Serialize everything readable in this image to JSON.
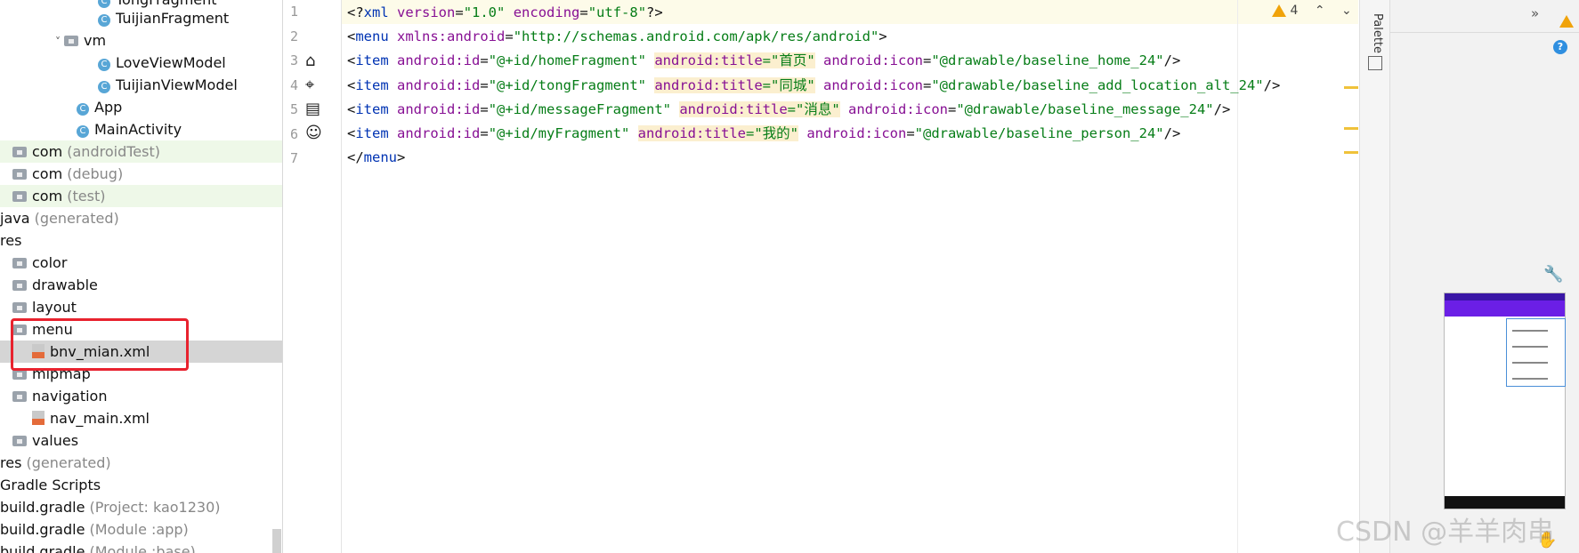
{
  "tree": {
    "rows": [
      {
        "label": "TongFragment",
        "muted": ""
      },
      {
        "label": "TuijianFragment",
        "muted": ""
      },
      {
        "label": "vm",
        "muted": ""
      },
      {
        "label": "LoveViewModel",
        "muted": ""
      },
      {
        "label": "TuijianViewModel",
        "muted": ""
      },
      {
        "label": "App",
        "muted": ""
      },
      {
        "label": "MainActivity",
        "muted": ""
      },
      {
        "label": "com",
        "muted": "(androidTest)"
      },
      {
        "label": "com",
        "muted": "(debug)"
      },
      {
        "label": "com",
        "muted": "(test)"
      },
      {
        "label": "java",
        "muted": "(generated)"
      },
      {
        "label": "res",
        "muted": ""
      },
      {
        "label": "color",
        "muted": ""
      },
      {
        "label": "drawable",
        "muted": ""
      },
      {
        "label": "layout",
        "muted": ""
      },
      {
        "label": "menu",
        "muted": ""
      },
      {
        "label": "bnv_mian.xml",
        "muted": ""
      },
      {
        "label": "mipmap",
        "muted": ""
      },
      {
        "label": "navigation",
        "muted": ""
      },
      {
        "label": "nav_main.xml",
        "muted": ""
      },
      {
        "label": "values",
        "muted": ""
      },
      {
        "label": "res",
        "muted": "(generated)"
      },
      {
        "label": "Gradle Scripts",
        "muted": ""
      },
      {
        "label": "build.gradle",
        "muted": "(Project: kao1230)"
      },
      {
        "label": "build.gradle",
        "muted": "(Module :app)"
      },
      {
        "label": "build.gradle",
        "muted": "(Module :base)"
      }
    ]
  },
  "editor": {
    "line_numbers": [
      "1",
      "2",
      "3",
      "4",
      "5",
      "6",
      "7"
    ],
    "warning_count": "4",
    "lines": [
      {
        "parts": [
          [
            "tag",
            "<?"
          ],
          [
            "kw",
            "xml"
          ],
          [
            "tag",
            " "
          ],
          [
            "attr",
            "version"
          ],
          [
            "tag",
            "="
          ],
          [
            "str",
            "\"1.0\""
          ],
          [
            "tag",
            " "
          ],
          [
            "attr",
            "encoding"
          ],
          [
            "tag",
            "="
          ],
          [
            "str",
            "\"utf-8\""
          ],
          [
            "tag",
            "?>"
          ]
        ]
      },
      {
        "parts": [
          [
            "tag",
            "<"
          ],
          [
            "kw",
            "menu"
          ],
          [
            "tag",
            " "
          ],
          [
            "attr",
            "xmlns:android"
          ],
          [
            "tag",
            "="
          ],
          [
            "str",
            "\"http://schemas.android.com/apk/res/android\""
          ],
          [
            "tag",
            ">"
          ]
        ]
      },
      {
        "parts": [
          [
            "tag",
            "<"
          ],
          [
            "kw",
            "item"
          ],
          [
            "tag",
            " "
          ],
          [
            "attr",
            "android:id"
          ],
          [
            "tag",
            "="
          ],
          [
            "str",
            "\"@+id/homeFragment\""
          ],
          [
            "tag",
            " "
          ],
          [
            "hattr",
            "android:title"
          ],
          [
            "hstr",
            "=\"首页\""
          ],
          [
            "tag",
            " "
          ],
          [
            "attr",
            "android:icon"
          ],
          [
            "tag",
            "="
          ],
          [
            "str",
            "\"@drawable/baseline_home_24\""
          ],
          [
            "tag",
            "/>"
          ]
        ]
      },
      {
        "parts": [
          [
            "tag",
            "<"
          ],
          [
            "kw",
            "item"
          ],
          [
            "tag",
            " "
          ],
          [
            "attr",
            "android:id"
          ],
          [
            "tag",
            "="
          ],
          [
            "str",
            "\"@+id/tongFragment\""
          ],
          [
            "tag",
            " "
          ],
          [
            "hattr",
            "android:title"
          ],
          [
            "hstr",
            "=\"同城\""
          ],
          [
            "tag",
            " "
          ],
          [
            "attr",
            "android:icon"
          ],
          [
            "tag",
            "="
          ],
          [
            "str",
            "\"@drawable/baseline_add_location_alt_24\""
          ],
          [
            "tag",
            "/>"
          ]
        ]
      },
      {
        "parts": [
          [
            "tag",
            "<"
          ],
          [
            "kw",
            "item"
          ],
          [
            "tag",
            " "
          ],
          [
            "attr",
            "android:id"
          ],
          [
            "tag",
            "="
          ],
          [
            "str",
            "\"@+id/messageFragment\""
          ],
          [
            "tag",
            " "
          ],
          [
            "hattr",
            "android:title"
          ],
          [
            "hstr",
            "=\"消息\""
          ],
          [
            "tag",
            " "
          ],
          [
            "attr",
            "android:icon"
          ],
          [
            "tag",
            "="
          ],
          [
            "str",
            "\"@drawable/baseline_message_24\""
          ],
          [
            "tag",
            "/>"
          ]
        ]
      },
      {
        "parts": [
          [
            "tag",
            "<"
          ],
          [
            "kw",
            "item"
          ],
          [
            "tag",
            " "
          ],
          [
            "attr",
            "android:id"
          ],
          [
            "tag",
            "="
          ],
          [
            "str",
            "\"@+id/myFragment\""
          ],
          [
            "tag",
            " "
          ],
          [
            "hattr",
            "android:title"
          ],
          [
            "hstr",
            "=\"我的\""
          ],
          [
            "tag",
            " "
          ],
          [
            "attr",
            "android:icon"
          ],
          [
            "tag",
            "="
          ],
          [
            "str",
            "\"@drawable/baseline_person_24\""
          ],
          [
            "tag",
            "/>"
          ]
        ]
      },
      {
        "parts": [
          [
            "tag",
            "</"
          ],
          [
            "kw",
            "menu"
          ],
          [
            "tag",
            ">"
          ]
        ]
      }
    ]
  },
  "side": {
    "palette_label": "Palette"
  },
  "watermark": "CSDN @羊羊肉串",
  "colors": {
    "accent_purple": "#6b1fe6",
    "warning": "#f0a30a",
    "highlight_box": "#e8222e"
  }
}
